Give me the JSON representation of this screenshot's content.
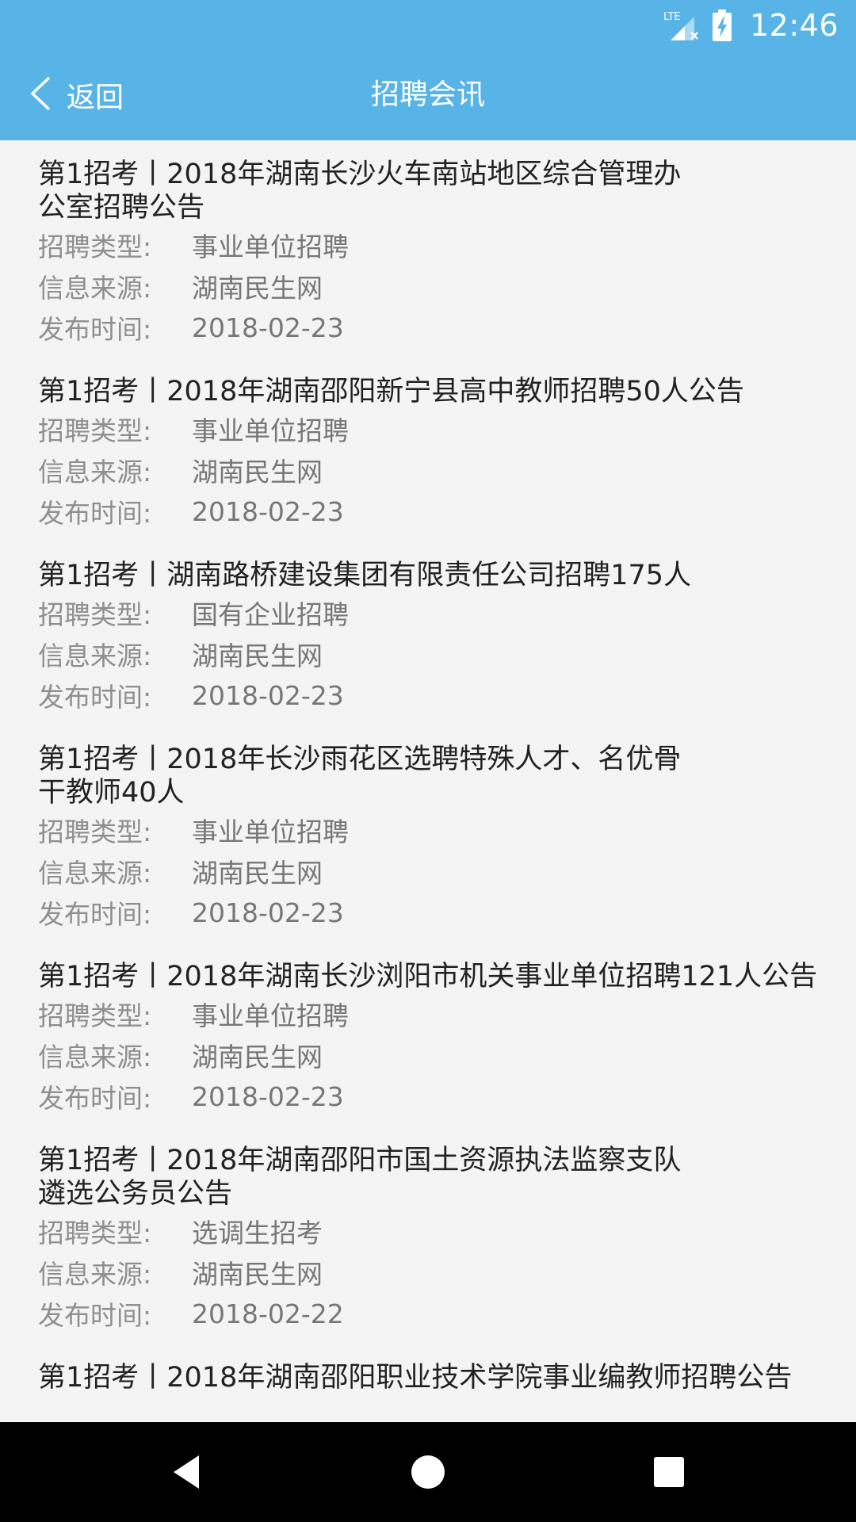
{
  "status_bar": {
    "network": "LTE",
    "time": "12:46",
    "icons": [
      "lte-signal-icon",
      "battery-charging-icon"
    ]
  },
  "app_bar": {
    "back_label": "返回",
    "title": "招聘会讯"
  },
  "list": {
    "items": [
      {
        "title": "第1招考丨2018年湖南长沙火车南站地区综合管理办公室招聘公告",
        "type_label": "招聘类型:",
        "type_value": "事业单位招聘",
        "source_label": "信息来源:",
        "source_value": "湖南民生网",
        "date_label": "发布时间:",
        "date_value": "2018-02-23"
      },
      {
        "title": "第1招考丨2018年湖南邵阳新宁县高中教师招聘50人公告",
        "type_label": "招聘类型:",
        "type_value": "事业单位招聘",
        "source_label": "信息来源:",
        "source_value": "湖南民生网",
        "date_label": "发布时间:",
        "date_value": "2018-02-23"
      },
      {
        "title": "第1招考丨湖南路桥建设集团有限责任公司招聘175人",
        "type_label": "招聘类型:",
        "type_value": "国有企业招聘",
        "source_label": "信息来源:",
        "source_value": "湖南民生网",
        "date_label": "发布时间:",
        "date_value": "2018-02-23"
      },
      {
        "title": "第1招考丨2018年长沙雨花区选聘特殊人才、名优骨干教师40人",
        "type_label": "招聘类型:",
        "type_value": "事业单位招聘",
        "source_label": "信息来源:",
        "source_value": "湖南民生网",
        "date_label": "发布时间:",
        "date_value": "2018-02-23"
      },
      {
        "title": "第1招考丨2018年湖南长沙浏阳市机关事业单位招聘121人公告",
        "type_label": "招聘类型:",
        "type_value": "事业单位招聘",
        "source_label": "信息来源:",
        "source_value": "湖南民生网",
        "date_label": "发布时间:",
        "date_value": "2018-02-23"
      },
      {
        "title": "第1招考丨2018年湖南邵阳市国土资源执法监察支队遴选公务员公告",
        "type_label": "招聘类型:",
        "type_value": "选调生招考",
        "source_label": "信息来源:",
        "source_value": "湖南民生网",
        "date_label": "发布时间:",
        "date_value": "2018-02-22"
      },
      {
        "title": "第1招考丨2018年湖南邵阳职业技术学院事业编教师招聘公告"
      }
    ]
  },
  "nav_bar": {
    "icons": [
      "back-triangle-icon",
      "home-circle-icon",
      "recents-square-icon"
    ]
  }
}
